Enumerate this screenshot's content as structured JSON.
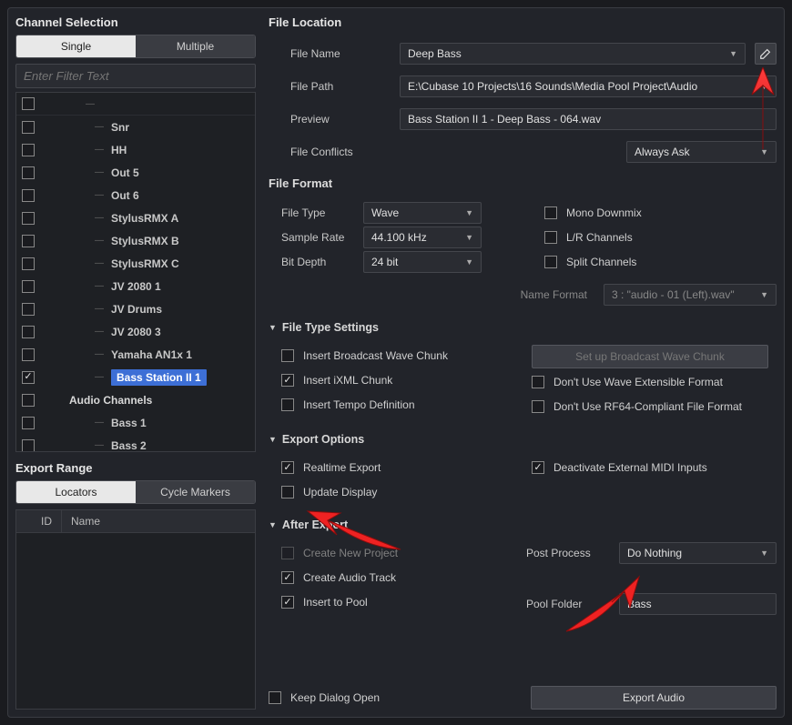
{
  "channel_selection": {
    "title": "Channel Selection",
    "tabs": {
      "single": "Single",
      "multiple": "Multiple",
      "active": "single"
    },
    "filter_placeholder": "Enter Filter Text",
    "tree": [
      {
        "label": "Snr",
        "indent": 2,
        "checked": false
      },
      {
        "label": "HH",
        "indent": 2,
        "checked": false
      },
      {
        "label": "Out 5",
        "indent": 2,
        "checked": false
      },
      {
        "label": "Out 6",
        "indent": 2,
        "checked": false
      },
      {
        "label": "StylusRMX A",
        "indent": 2,
        "checked": false
      },
      {
        "label": "StylusRMX B",
        "indent": 2,
        "checked": false
      },
      {
        "label": "StylusRMX C",
        "indent": 2,
        "checked": false
      },
      {
        "label": "JV 2080 1",
        "indent": 2,
        "checked": false
      },
      {
        "label": "JV Drums",
        "indent": 2,
        "checked": false
      },
      {
        "label": "JV 2080 3",
        "indent": 2,
        "checked": false
      },
      {
        "label": "Yamaha AN1x 1",
        "indent": 2,
        "checked": false
      },
      {
        "label": "Bass Station II 1",
        "indent": 2,
        "checked": true,
        "selected": true
      },
      {
        "label": "Audio Channels",
        "indent": 1,
        "checked": false,
        "group": true
      },
      {
        "label": "Bass 1",
        "indent": 2,
        "checked": false
      },
      {
        "label": "Bass 2",
        "indent": 2,
        "checked": false
      }
    ]
  },
  "export_range": {
    "title": "Export Range",
    "tabs": {
      "locators": "Locators",
      "cycle_markers": "Cycle Markers",
      "active": "locators"
    },
    "columns": {
      "id": "ID",
      "name": "Name"
    }
  },
  "file_location": {
    "title": "File Location",
    "file_name_label": "File Name",
    "file_name_value": "Deep Bass",
    "file_path_label": "File Path",
    "file_path_value": "E:\\Cubase 10 Projects\\16 Sounds\\Media Pool Project\\Audio",
    "preview_label": "Preview",
    "preview_value": "Bass Station II 1 - Deep Bass - 064.wav",
    "conflicts_label": "File Conflicts",
    "conflicts_value": "Always Ask"
  },
  "file_format": {
    "title": "File Format",
    "file_type_label": "File Type",
    "file_type_value": "Wave",
    "sample_rate_label": "Sample Rate",
    "sample_rate_value": "44.100 kHz",
    "bit_depth_label": "Bit Depth",
    "bit_depth_value": "24 bit",
    "mono_downmix": "Mono Downmix",
    "lr_channels": "L/R Channels",
    "split_channels": "Split Channels",
    "name_format_label": "Name Format",
    "name_format_value": "3 : \"audio - 01 (Left).wav\""
  },
  "file_type_settings": {
    "title": "File Type Settings",
    "insert_bwav": "Insert Broadcast Wave Chunk",
    "setup_bwav_btn": "Set up Broadcast Wave Chunk",
    "insert_ixml": "Insert iXML Chunk",
    "no_wave_ext": "Don't Use Wave Extensible Format",
    "insert_tempo": "Insert Tempo Definition",
    "no_rf64": "Don't Use RF64-Compliant File Format"
  },
  "export_options": {
    "title": "Export Options",
    "realtime": "Realtime Export",
    "deactivate_midi": "Deactivate External MIDI Inputs",
    "update_display": "Update Display"
  },
  "after_export": {
    "title": "After Export",
    "create_project": "Create New Project",
    "create_track": "Create Audio Track",
    "insert_pool": "Insert to Pool",
    "post_process_label": "Post Process",
    "post_process_value": "Do Nothing",
    "pool_folder_label": "Pool Folder",
    "pool_folder_value": "Bass"
  },
  "footer": {
    "keep_open": "Keep Dialog Open",
    "export_btn": "Export Audio"
  }
}
